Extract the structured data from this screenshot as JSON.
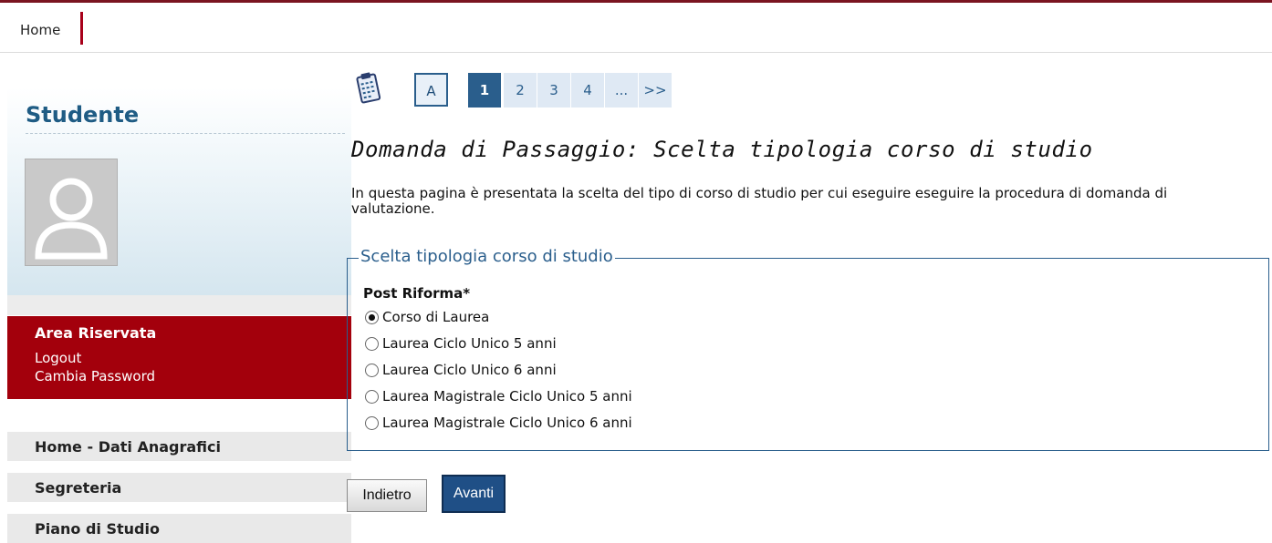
{
  "topnav": {
    "home_label": "Home"
  },
  "sidebar": {
    "title": "Studente",
    "area": {
      "title": "Area Riservata",
      "links": [
        "Logout",
        "Cambia Password"
      ]
    },
    "menu": [
      "Home - Dati Anagrafici",
      "Segreteria",
      "Piano di Studio"
    ]
  },
  "steps": [
    "A",
    "1",
    "2",
    "3",
    "4",
    "...",
    ">>"
  ],
  "active_step": "1",
  "page": {
    "title": "Domanda di Passaggio: Scelta tipologia corso di studio",
    "intro": "In questa pagina è presentata la scelta del tipo di corso di studio per cui eseguire eseguire la procedura di domanda di valutazione."
  },
  "form": {
    "legend": "Scelta tipologia corso di studio",
    "group_label": "Post Riforma*",
    "options": [
      "Corso di Laurea",
      "Laurea Ciclo Unico 5 anni",
      "Laurea Ciclo Unico 6 anni",
      "Laurea Magistrale Ciclo Unico 5 anni",
      "Laurea Magistrale Ciclo Unico 6 anni"
    ],
    "selected": "Corso di Laurea"
  },
  "buttons": {
    "back": "Indietro",
    "next": "Avanti"
  },
  "colors": {
    "accent": "#a3000c",
    "brand_blue": "#2a5e8c",
    "topline": "#7a1420"
  },
  "icons": {
    "clipboard": "clipboard-icon",
    "avatar": "user-avatar-icon"
  }
}
